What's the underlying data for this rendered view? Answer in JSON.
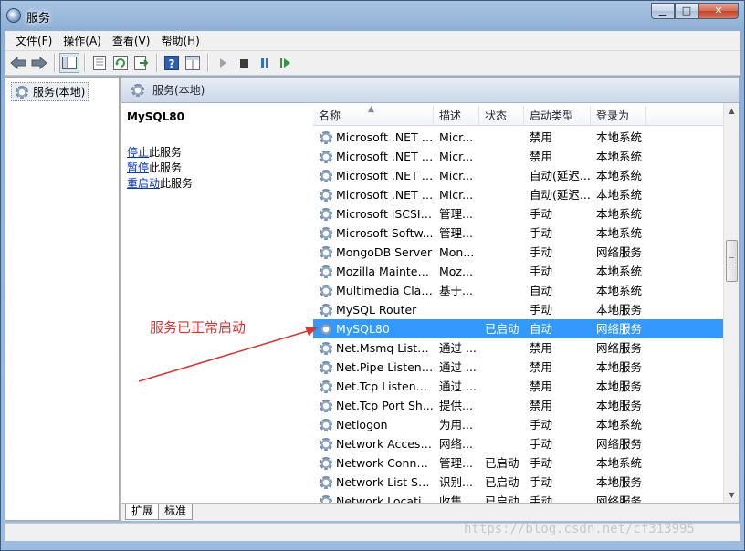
{
  "window": {
    "title": "服务"
  },
  "menu": [
    "文件(F)",
    "操作(A)",
    "查看(V)",
    "帮助(H)"
  ],
  "tree": {
    "root": "服务(本地)"
  },
  "pane": {
    "header": "服务(本地)"
  },
  "detail": {
    "title": "MySQL80",
    "stop_link": "停止",
    "stop_suffix": "此服务",
    "pause_link": "暂停",
    "pause_suffix": "此服务",
    "restart_link": "重启动",
    "restart_suffix": "此服务"
  },
  "columns": {
    "name": "名称",
    "desc": "描述",
    "state": "状态",
    "start": "启动类型",
    "logon": "登录为"
  },
  "rows": [
    {
      "name": "Microsoft .NET F...",
      "desc": "Micr...",
      "state": "",
      "start": "禁用",
      "logon": "本地系统"
    },
    {
      "name": "Microsoft .NET F...",
      "desc": "Micr...",
      "state": "",
      "start": "禁用",
      "logon": "本地系统"
    },
    {
      "name": "Microsoft .NET F...",
      "desc": "Micr...",
      "state": "",
      "start": "自动(延迟...",
      "logon": "本地系统"
    },
    {
      "name": "Microsoft .NET F...",
      "desc": "Micr...",
      "state": "",
      "start": "自动(延迟...",
      "logon": "本地系统"
    },
    {
      "name": "Microsoft iSCSI I...",
      "desc": "管理...",
      "state": "",
      "start": "手动",
      "logon": "本地系统"
    },
    {
      "name": "Microsoft Softw...",
      "desc": "管理...",
      "state": "",
      "start": "手动",
      "logon": "本地系统"
    },
    {
      "name": "MongoDB Server",
      "desc": "Mon...",
      "state": "",
      "start": "手动",
      "logon": "网络服务"
    },
    {
      "name": "Mozilla Mainten...",
      "desc": "Moz...",
      "state": "",
      "start": "手动",
      "logon": "本地系统"
    },
    {
      "name": "Multimedia Clas...",
      "desc": "基于...",
      "state": "",
      "start": "自动",
      "logon": "本地系统"
    },
    {
      "name": "MySQL Router",
      "desc": "",
      "state": "",
      "start": "手动",
      "logon": "本地服务"
    },
    {
      "name": "MySQL80",
      "desc": "",
      "state": "已启动",
      "start": "自动",
      "logon": "网络服务",
      "selected": true
    },
    {
      "name": "Net.Msmq Liste...",
      "desc": "通过 ...",
      "state": "",
      "start": "禁用",
      "logon": "网络服务"
    },
    {
      "name": "Net.Pipe Listene...",
      "desc": "通过 ...",
      "state": "",
      "start": "禁用",
      "logon": "本地服务"
    },
    {
      "name": "Net.Tcp Listener...",
      "desc": "通过 ...",
      "state": "",
      "start": "禁用",
      "logon": "本地服务"
    },
    {
      "name": "Net.Tcp Port Sh...",
      "desc": "提供...",
      "state": "",
      "start": "禁用",
      "logon": "本地服务"
    },
    {
      "name": "Netlogon",
      "desc": "为用...",
      "state": "",
      "start": "手动",
      "logon": "本地系统"
    },
    {
      "name": "Network Access ...",
      "desc": "网络...",
      "state": "",
      "start": "手动",
      "logon": "网络服务"
    },
    {
      "name": "Network Connec...",
      "desc": "管理...",
      "state": "已启动",
      "start": "手动",
      "logon": "本地系统"
    },
    {
      "name": "Network List Ser...",
      "desc": "识别...",
      "state": "已启动",
      "start": "手动",
      "logon": "本地服务"
    },
    {
      "name": "Network Locatio...",
      "desc": "收集...",
      "state": "已启动",
      "start": "手动",
      "logon": "网络服务"
    }
  ],
  "tabs": [
    "扩展",
    "标准"
  ],
  "annotation": "服务已正常启动",
  "watermark": "https://blog.csdn.net/cf313995",
  "colors": {
    "selection": "#3399ff",
    "annotation": "#e03030",
    "link": "#0033cc"
  },
  "icons": {
    "app": "services-icon",
    "service": "gear-icon"
  }
}
